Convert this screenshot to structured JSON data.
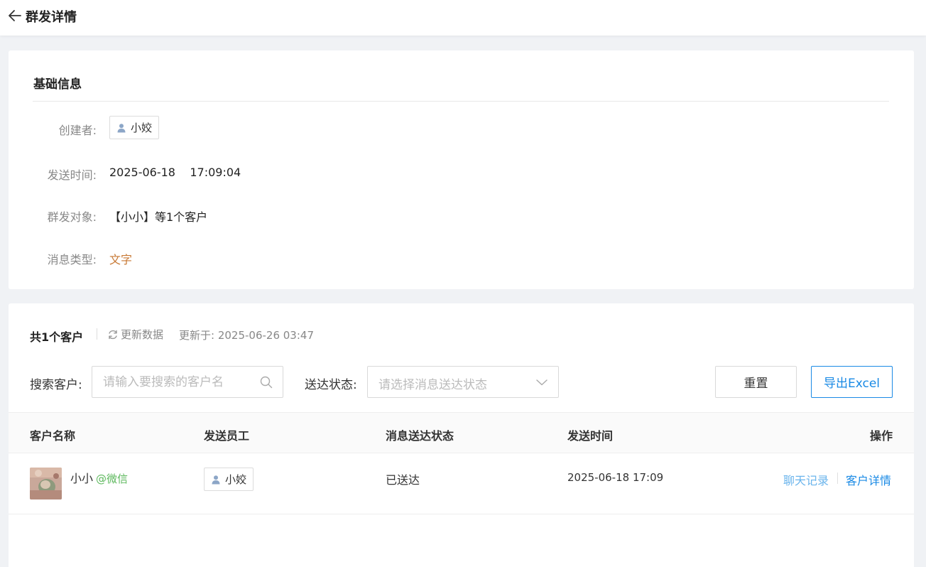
{
  "header": {
    "title": "群发详情",
    "back_icon": "arrow-left-icon"
  },
  "basic_info": {
    "section_title": "基础信息",
    "creator_label": "创建者:",
    "creator_name": "小姣",
    "send_time_label": "发送时间:",
    "send_time_value": "2025-06-18    17:09:04",
    "target_label": "群发对象:",
    "target_value": "【小小】等1个客户",
    "msg_type_label": "消息类型:",
    "msg_type_value": "文字",
    "msg_type_color": "#c87a36"
  },
  "customers": {
    "total": "共1个客户",
    "refresh_label": "更新数据",
    "refresh_icon": "refresh-icon",
    "updated_at": "更新于: 2025-06-26 03:47",
    "search_label": "搜索客户:",
    "search_placeholder": "请输入要搜索的客户名",
    "search_icon": "search-icon",
    "status_label": "送达状态:",
    "status_placeholder": "请选择消息送达状态",
    "status_icon": "chevron-down-icon",
    "reset_label": "重置",
    "export_label": "导出Excel",
    "accent_color": "#1a8ae5"
  },
  "table": {
    "headers": {
      "customer": "客户名称",
      "staff": "发送员工",
      "status": "消息送达状态",
      "time": "发送时间",
      "actions": "操作"
    },
    "rows": [
      {
        "name": "小小",
        "source": "@微信",
        "staff": "小姣",
        "status": "已送达",
        "time": "2025-06-18 17:09",
        "chat_link": "聊天记录",
        "detail_link": "客户详情"
      }
    ]
  }
}
